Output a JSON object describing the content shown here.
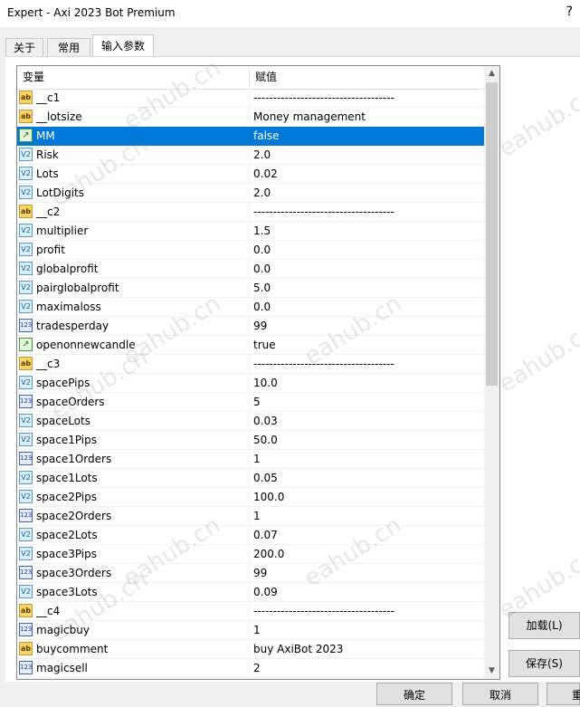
{
  "window": {
    "title": "Expert - Axi 2023 Bot Premium",
    "help": "?"
  },
  "tabs": [
    {
      "label": "关于",
      "active": false
    },
    {
      "label": "常用",
      "active": false
    },
    {
      "label": "输入参数",
      "active": true
    }
  ],
  "grid": {
    "header": {
      "variable": "变量",
      "value": "赋值"
    },
    "rows": [
      {
        "icon": "string-icon",
        "name": "__c1",
        "value": "------------------------------------",
        "selected": false
      },
      {
        "icon": "string-icon",
        "name": "__lotsize",
        "value": "Money management",
        "selected": false
      },
      {
        "icon": "bool-icon",
        "name": "MM",
        "value": "false",
        "selected": true
      },
      {
        "icon": "double-icon",
        "name": "Risk",
        "value": "2.0",
        "selected": false
      },
      {
        "icon": "double-icon",
        "name": "Lots",
        "value": "0.02",
        "selected": false
      },
      {
        "icon": "double-icon",
        "name": "LotDigits",
        "value": "2.0",
        "selected": false
      },
      {
        "icon": "string-icon",
        "name": "__c2",
        "value": "------------------------------------",
        "selected": false
      },
      {
        "icon": "double-icon",
        "name": "multiplier",
        "value": "1.5",
        "selected": false
      },
      {
        "icon": "double-icon",
        "name": "profit",
        "value": "0.0",
        "selected": false
      },
      {
        "icon": "double-icon",
        "name": "globalprofit",
        "value": "0.0",
        "selected": false
      },
      {
        "icon": "double-icon",
        "name": "pairglobalprofit",
        "value": "5.0",
        "selected": false
      },
      {
        "icon": "double-icon",
        "name": "maximaloss",
        "value": "0.0",
        "selected": false
      },
      {
        "icon": "integer-icon",
        "name": "tradesperday",
        "value": "99",
        "selected": false
      },
      {
        "icon": "bool-icon",
        "name": "openonnewcandle",
        "value": "true",
        "selected": false
      },
      {
        "icon": "string-icon",
        "name": "__c3",
        "value": "------------------------------------",
        "selected": false
      },
      {
        "icon": "double-icon",
        "name": "spacePips",
        "value": "10.0",
        "selected": false
      },
      {
        "icon": "integer-icon",
        "name": "spaceOrders",
        "value": "5",
        "selected": false
      },
      {
        "icon": "double-icon",
        "name": "spaceLots",
        "value": "0.03",
        "selected": false
      },
      {
        "icon": "double-icon",
        "name": "space1Pips",
        "value": "50.0",
        "selected": false
      },
      {
        "icon": "integer-icon",
        "name": "space1Orders",
        "value": "1",
        "selected": false
      },
      {
        "icon": "double-icon",
        "name": "space1Lots",
        "value": "0.05",
        "selected": false
      },
      {
        "icon": "double-icon",
        "name": "space2Pips",
        "value": "100.0",
        "selected": false
      },
      {
        "icon": "integer-icon",
        "name": "space2Orders",
        "value": "1",
        "selected": false
      },
      {
        "icon": "double-icon",
        "name": "space2Lots",
        "value": "0.07",
        "selected": false
      },
      {
        "icon": "double-icon",
        "name": "space3Pips",
        "value": "200.0",
        "selected": false
      },
      {
        "icon": "integer-icon",
        "name": "space3Orders",
        "value": "99",
        "selected": false
      },
      {
        "icon": "double-icon",
        "name": "space3Lots",
        "value": "0.09",
        "selected": false
      },
      {
        "icon": "string-icon",
        "name": "__c4",
        "value": "------------------------------------",
        "selected": false
      },
      {
        "icon": "integer-icon",
        "name": "magicbuy",
        "value": "1",
        "selected": false
      },
      {
        "icon": "string-icon",
        "name": "buycomment",
        "value": "buy AxiBot 2023",
        "selected": false
      },
      {
        "icon": "integer-icon",
        "name": "magicsell",
        "value": "2",
        "selected": false
      }
    ]
  },
  "icon_glyphs": {
    "string-icon": "ab",
    "double-icon": "V2",
    "integer-icon": "123",
    "bool-icon": "↗"
  },
  "buttons": {
    "load": "加载(L)",
    "save": "保存(S)",
    "ok": "确定",
    "cancel": "取消",
    "reset": "重"
  },
  "watermark": "eahub.cn",
  "colors": {
    "selection": "#0078d7"
  }
}
